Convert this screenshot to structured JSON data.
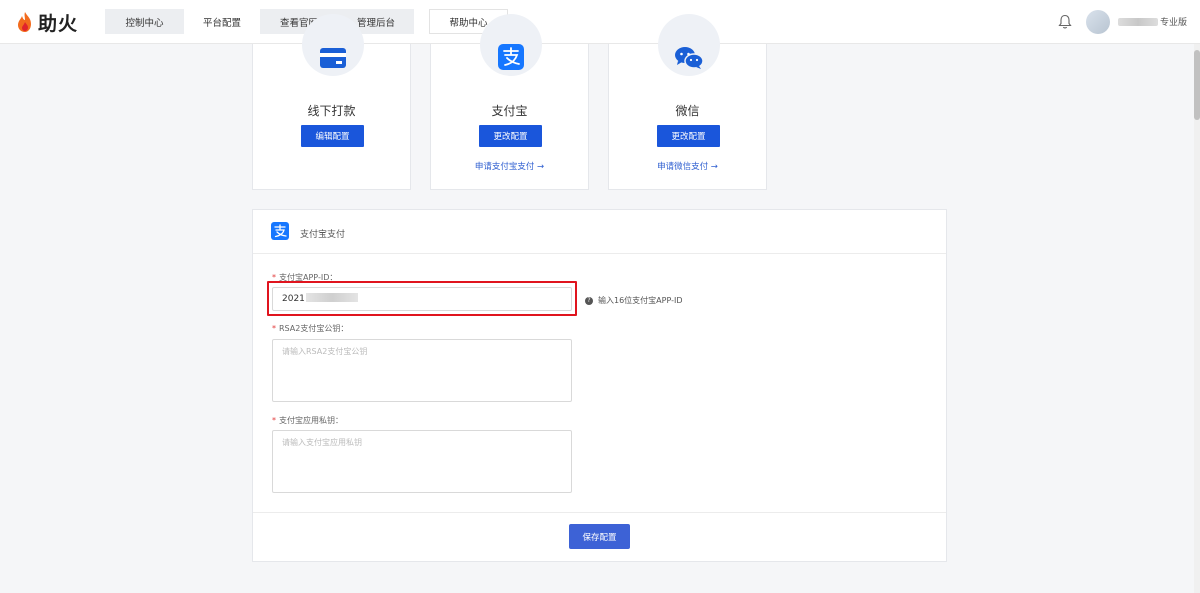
{
  "header": {
    "logo_text": "助火",
    "nav": [
      {
        "label": "控制中心"
      },
      {
        "label": "平台配置"
      },
      {
        "label": "查看官网"
      },
      {
        "label": "管理后台"
      }
    ],
    "help_label": "帮助中心",
    "plan_label": "专业版"
  },
  "payment_methods": [
    {
      "title": "线下打款",
      "button": "编辑配置",
      "icon": "card-icon"
    },
    {
      "title": "支付宝",
      "button": "更改配置",
      "link": "申请支付宝支付 →",
      "icon": "alipay-icon"
    },
    {
      "title": "微信",
      "button": "更改配置",
      "link": "申请微信支付 →",
      "icon": "wechat-icon"
    }
  ],
  "panel": {
    "title": "支付宝支付",
    "app_id": {
      "required_mark": "*",
      "label": "支付宝APP-ID：",
      "value_prefix": "2021",
      "hint": "输入16位支付宝APP-ID"
    },
    "public_key": {
      "required_mark": "*",
      "label": "RSA2支付宝公钥：",
      "placeholder": "请输入RSA2支付宝公钥"
    },
    "private_key": {
      "required_mark": "*",
      "label": "支付宝应用私钥：",
      "placeholder": "请输入支付宝应用私钥"
    },
    "save_label": "保存配置"
  },
  "colors": {
    "primary": "#1a56db",
    "save": "#3d62d6",
    "highlight": "#e0141e",
    "link": "#2f5fd0"
  }
}
